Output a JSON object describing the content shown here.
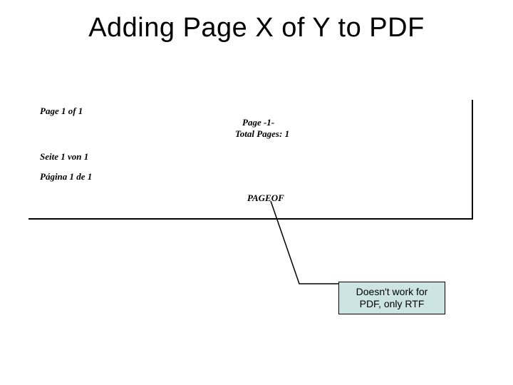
{
  "title": "Adding Page X of Y to PDF",
  "pdf_preview": {
    "top_left": "Page 1 of 1",
    "center_page": "Page -1-",
    "center_total": "Total Pages: 1",
    "seite": "Seite 1 von 1",
    "pagina": "Página 1 de 1",
    "pageof": "PAGEOF"
  },
  "callout": {
    "line1": "Doesn't work for",
    "line2": "PDF, only RTF"
  }
}
